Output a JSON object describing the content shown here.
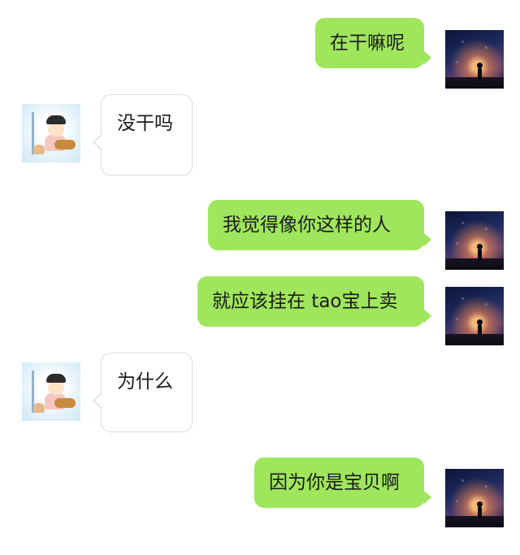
{
  "conversation": {
    "messages": [
      {
        "sender": "me",
        "text": "在干嘛呢"
      },
      {
        "sender": "other",
        "text": "没干吗"
      },
      {
        "sender": "me",
        "text": "我觉得像你这样的人"
      },
      {
        "sender": "me",
        "text": "就应该挂在 tao宝上卖"
      },
      {
        "sender": "other",
        "text": "为什么"
      },
      {
        "sender": "me",
        "text": "因为你是宝贝啊"
      }
    ]
  },
  "colors": {
    "outgoing_bubble": "#9fe65c",
    "incoming_bubble": "#ffffff",
    "incoming_border": "#dcdcdc",
    "background": "#ffffff"
  },
  "icons": {
    "my_avatar": "night-sky-silhouette-avatar",
    "their_avatar": "cartoon-girl-with-guitar-avatar"
  }
}
